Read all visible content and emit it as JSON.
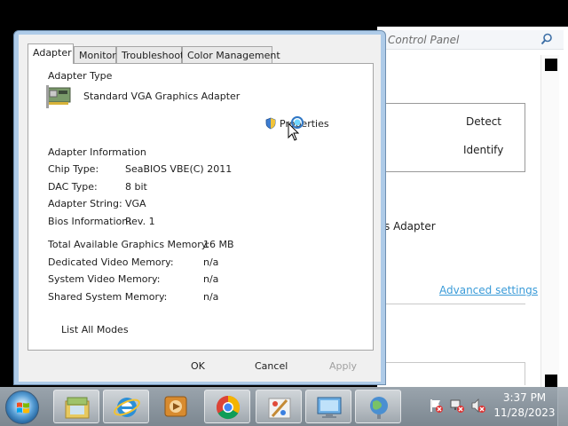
{
  "control_panel": {
    "search_placeholder": "Control Panel",
    "detect_label": "Detect",
    "identify_label": "Identify",
    "adapter_fragment": "s Adapter",
    "advanced_settings_link": "Advanced settings"
  },
  "dialog": {
    "tabs": [
      "Adapter",
      "Monitor",
      "Troubleshoot",
      "Color Management"
    ],
    "adapter_type_heading": "Adapter Type",
    "adapter_name": "Standard VGA Graphics Adapter",
    "properties_label": "Properties",
    "adapter_info_heading": "Adapter Information",
    "info": [
      {
        "label": "Chip Type:",
        "value": "SeaBIOS VBE(C) 2011"
      },
      {
        "label": "DAC Type:",
        "value": "8 bit"
      },
      {
        "label": "Adapter String:",
        "value": "VGA"
      },
      {
        "label": "Bios Information:",
        "value": "Rev. 1"
      }
    ],
    "memory": [
      {
        "label": "Total Available Graphics Memory:",
        "value": "16 MB"
      },
      {
        "label": "Dedicated Video Memory:",
        "value": "n/a"
      },
      {
        "label": "System Video Memory:",
        "value": "n/a"
      },
      {
        "label": "Shared System Memory:",
        "value": "n/a"
      }
    ],
    "list_all_modes_label": "List All Modes",
    "ok_label": "OK",
    "cancel_label": "Cancel",
    "apply_label": "Apply"
  },
  "taskbar": {
    "items": [
      "file-manager-icon",
      "internet-explorer-icon",
      "media-player-icon",
      "chrome-icon",
      "paint-icon",
      "display-settings-icon",
      "network-globe-icon"
    ],
    "time": "3:37 PM",
    "date": "11/28/2023"
  }
}
